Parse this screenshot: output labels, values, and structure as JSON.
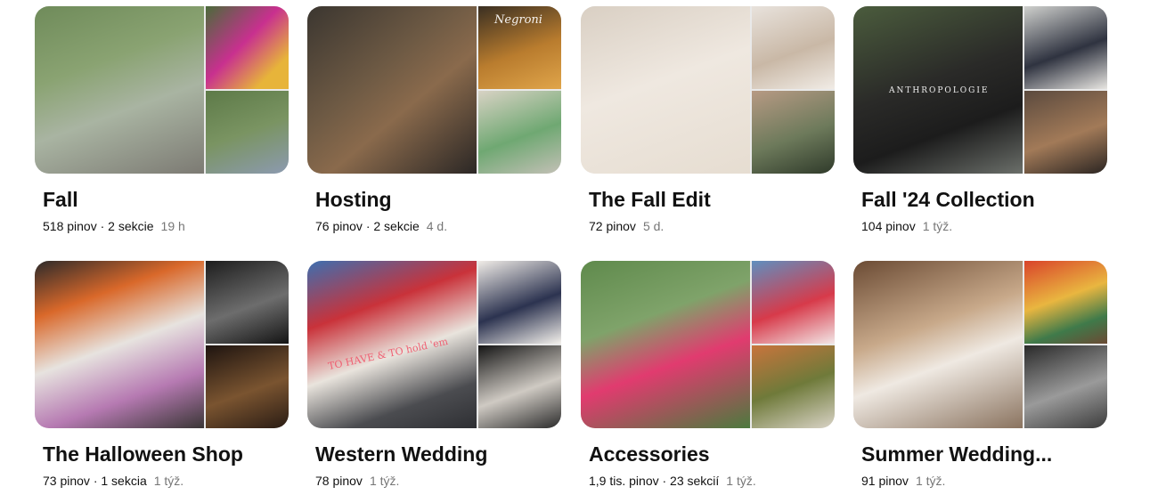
{
  "boards": [
    {
      "title": "Fall",
      "count": "518 pinov · 2 sekcie",
      "age": "19 h",
      "colors": {
        "main": "linear-gradient(160deg,#6f8b5a 0%,#8aa372 35%,#a9b4a2 60%,#7c7a73 100%)",
        "side1": "linear-gradient(135deg,#4a6b3a 0%,#c8308f 45%,#e7b43a 80%)",
        "side2": "linear-gradient(160deg,#5d7a48 0%,#7a9462 50%,#8c9ab0 100%)"
      }
    },
    {
      "title": "Hosting",
      "count": "76 pinov · 2 sekcie",
      "age": "4 d.",
      "colors": {
        "main": "linear-gradient(140deg,#3b3630 0%,#6e5a44 40%,#8a6a4c 60%,#2b2725 100%)",
        "side1": "linear-gradient(160deg,#3a2f22 0%,#b97c2e 55%,#e0a54a 100%)",
        "side2": "linear-gradient(160deg,#d8d2c4 0%,#6fa872 55%,#c3c0b6 100%)"
      },
      "side1_text": "Negroni"
    },
    {
      "title": "The Fall Edit",
      "count": "72 pinov",
      "age": "5 d.",
      "colors": {
        "main": "linear-gradient(160deg,#d9cfc3 0%,#efe8e0 45%,#e6ddd1 100%)",
        "side1": "linear-gradient(160deg,#e8e2dc 0%,#c9b8a6 55%,#f1ece6 100%)",
        "side2": "linear-gradient(160deg,#b79a84 0%,#6d7a5b 55%,#2f3a2a 100%)"
      }
    },
    {
      "title": "Fall '24 Collection",
      "count": "104 pinov",
      "age": "1 týž.",
      "colors": {
        "main": "linear-gradient(160deg,#4b5c3d 0%,#2a2a28 45%,#1c1c1c 70%,#6b6f6a 100%)",
        "side1": "linear-gradient(160deg,#cfd0cd 0%,#2f3340 55%,#e8e6e2 100%)",
        "side2": "linear-gradient(160deg,#5b4a3e 0%,#a27a58 55%,#2b2522 100%)"
      },
      "main_text": "ANTHROPOLOGIE"
    },
    {
      "title": "The Halloween Shop",
      "count": "73 pinov · 1 sekcia",
      "age": "1 týž.",
      "colors": {
        "main": "linear-gradient(160deg,#2d2a2a 0%,#d9682a 25%,#e7e3df 50%,#b67ab2 75%,#3a3636 100%)",
        "side1": "linear-gradient(160deg,#1d1d1d 0%,#6d6d6d 55%,#141414 100%)",
        "side2": "linear-gradient(160deg,#1e1410 0%,#7a5430 55%,#2a1c14 100%)"
      }
    },
    {
      "title": "Western Wedding",
      "count": "78 pinov",
      "age": "1 týž.",
      "colors": {
        "main": "linear-gradient(160deg,#3d6fb0 0%,#c9323a 30%,#e9e4dd 55%,#4b4c50 80%,#2e2f33 100%)",
        "side1": "linear-gradient(160deg,#f0ece7 0%,#2c3350 55%,#f4f1ec 100%)",
        "side2": "linear-gradient(160deg,#151515 0%,#cfcac3 55%,#2b2b2b 100%)"
      },
      "main_text": "TO HAVE & TO hold 'em"
    },
    {
      "title": "Accessories",
      "count": "1,9 tis. pinov · 23 sekcií",
      "age": "1 týž.",
      "colors": {
        "main": "linear-gradient(160deg,#5f8a4c 0%,#7fa36a 35%,#e13b6f 60%,#4c7a3e 100%)",
        "side1": "linear-gradient(160deg,#5f8fbf 0%,#d73a4a 55%,#f2e6e6 100%)",
        "side2": "linear-gradient(160deg,#c8743c 0%,#6f7a3a 50%,#d9d3c6 100%)"
      }
    },
    {
      "title": "Summer Wedding...",
      "count": "91 pinov",
      "age": "1 týž.",
      "colors": {
        "main": "linear-gradient(160deg,#6b4b34 0%,#c8a98a 40%,#efe9e2 60%,#8a735f 100%)",
        "side1": "linear-gradient(160deg,#d9432a 0%,#e9b640 45%,#3f7a4a 75%,#6b4a34 100%)",
        "side2": "linear-gradient(160deg,#2a2a2a 0%,#9a9a9a 55%,#3b3b3b 100%)"
      }
    }
  ]
}
